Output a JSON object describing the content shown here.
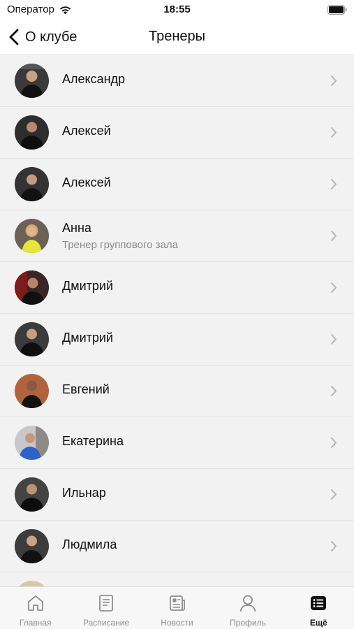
{
  "status_bar": {
    "carrier": "Оператор",
    "time": "18:55"
  },
  "nav": {
    "back_label": "О клубе",
    "title": "Тренеры"
  },
  "trainers": [
    {
      "name": "Александр",
      "subtitle": ""
    },
    {
      "name": "Алексей",
      "subtitle": ""
    },
    {
      "name": "Алексей",
      "subtitle": ""
    },
    {
      "name": "Анна",
      "subtitle": "Тренер группового зала"
    },
    {
      "name": "Дмитрий",
      "subtitle": ""
    },
    {
      "name": "Дмитрий",
      "subtitle": ""
    },
    {
      "name": "Евгений",
      "subtitle": ""
    },
    {
      "name": "Екатерина",
      "subtitle": ""
    },
    {
      "name": "Ильнар",
      "subtitle": ""
    },
    {
      "name": "Людмила",
      "subtitle": ""
    }
  ],
  "tabs": [
    {
      "label": "Главная",
      "icon": "home-icon",
      "active": false
    },
    {
      "label": "Расписание",
      "icon": "schedule-icon",
      "active": false
    },
    {
      "label": "Новости",
      "icon": "news-icon",
      "active": false
    },
    {
      "label": "Профиль",
      "icon": "profile-icon",
      "active": false
    },
    {
      "label": "Ещё",
      "icon": "more-icon",
      "active": true
    }
  ],
  "colors": {
    "background": "#f2f2f2",
    "active_tab": "#111111",
    "inactive_tab": "#8e8e8e",
    "subtitle": "#8a8a8a"
  }
}
